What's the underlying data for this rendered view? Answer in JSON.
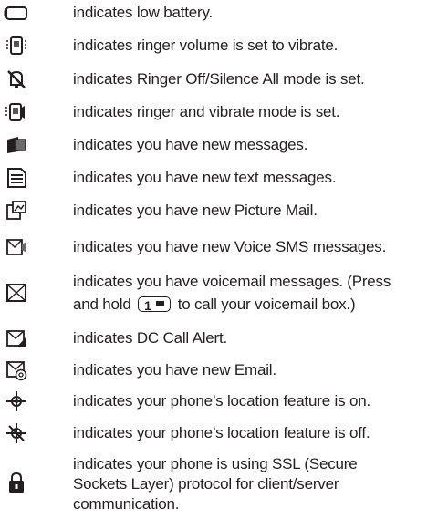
{
  "items": [
    {
      "icon": "battery-low-icon",
      "text": "indicates low battery."
    },
    {
      "icon": "vibrate-icon",
      "text": "indicates ringer volume is set to vibrate."
    },
    {
      "icon": "ringer-off-icon",
      "text": "indicates Ringer Off/Silence All mode is set."
    },
    {
      "icon": "ringer-vibrate-icon",
      "text": "indicates ringer and vibrate mode is set."
    },
    {
      "icon": "new-messages-icon",
      "text": "indicates you have new messages."
    },
    {
      "icon": "text-message-icon",
      "text": "indicates you have new text messages."
    },
    {
      "icon": "picture-mail-icon",
      "text": "indicates you have new Picture Mail."
    },
    {
      "icon": "voice-sms-icon",
      "text": "indicates you have new Voice SMS messages."
    },
    {
      "icon": "voicemail-icon",
      "text": "indicates you have voicemail messages. (Press",
      "text2_pre": "and hold",
      "key_label": "1",
      "text2_post": "to call your voicemail box.)"
    },
    {
      "icon": "dc-call-alert-icon",
      "text": "indicates DC Call Alert."
    },
    {
      "icon": "email-icon",
      "text": "indicates you have new Email."
    },
    {
      "icon": "location-on-icon",
      "text": "indicates your phone’s location feature is on."
    },
    {
      "icon": "location-off-icon",
      "text": "indicates your phone’s location feature is off."
    },
    {
      "icon": "ssl-lock-icon",
      "text": "indicates your phone is using SSL (Secure",
      "text2": "Sockets Layer) protocol for client/server",
      "text3": "communication."
    }
  ]
}
